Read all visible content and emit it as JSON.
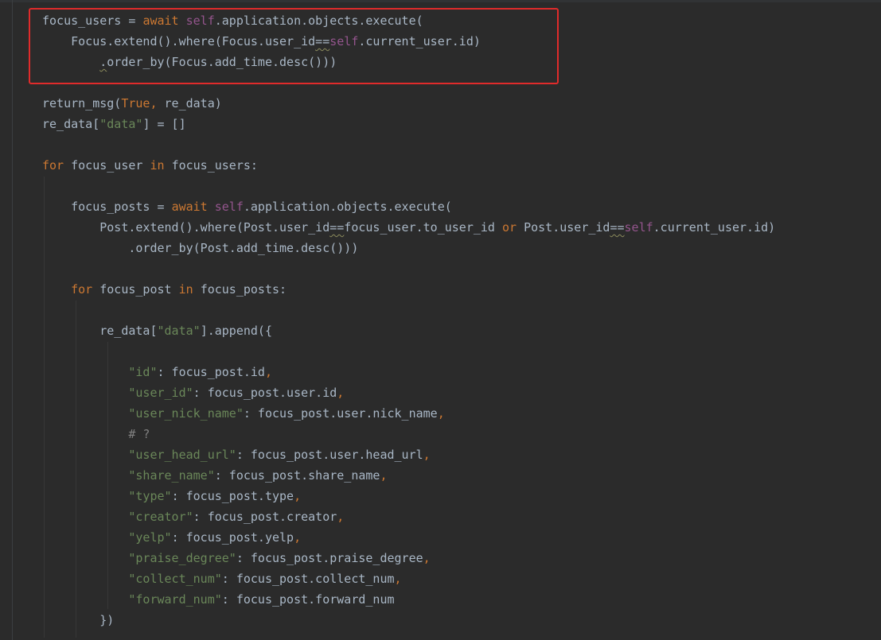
{
  "editor": {
    "highlight_color": "#e02b2b",
    "colors": {
      "background": "#2b2b2b",
      "plain": "#a9b7c6",
      "keyword": "#cc7832",
      "self": "#94558d",
      "string": "#6a8759",
      "comment": "#808080"
    },
    "lines": [
      [
        [
          "plain",
          "focus_users = "
        ],
        [
          "kw",
          "await "
        ],
        [
          "self",
          "self"
        ],
        [
          "plain",
          ".application.objects.execute("
        ]
      ],
      [
        [
          "plain",
          "    Focus.extend().where(Focus.user_id"
        ],
        [
          "warn",
          "=="
        ],
        [
          "self",
          "self"
        ],
        [
          "plain",
          ".current_user.id)"
        ]
      ],
      [
        [
          "plain",
          "        "
        ],
        [
          "warn",
          "."
        ],
        [
          "plain",
          "order_by(Focus.add_time.desc()))"
        ]
      ],
      [],
      [
        [
          "plain",
          "return_msg("
        ],
        [
          "kw",
          "True"
        ],
        [
          "punc",
          ", "
        ],
        [
          "plain",
          "re_data)"
        ]
      ],
      [
        [
          "plain",
          "re_data["
        ],
        [
          "str",
          "\"data\""
        ],
        [
          "plain",
          "] = []"
        ]
      ],
      [],
      [
        [
          "kw",
          "for "
        ],
        [
          "plain",
          "focus_user "
        ],
        [
          "kw",
          "in "
        ],
        [
          "plain",
          "focus_users:"
        ]
      ],
      [],
      [
        [
          "plain",
          "    focus_posts = "
        ],
        [
          "kw",
          "await "
        ],
        [
          "self",
          "self"
        ],
        [
          "plain",
          ".application.objects.execute("
        ]
      ],
      [
        [
          "plain",
          "        Post.extend().where(Post.user_id"
        ],
        [
          "warn",
          "=="
        ],
        [
          "plain",
          "focus_user.to_user_id "
        ],
        [
          "kw",
          "or "
        ],
        [
          "plain",
          "Post.user_id"
        ],
        [
          "warn",
          "=="
        ],
        [
          "self",
          "self"
        ],
        [
          "plain",
          ".current_user.id)"
        ]
      ],
      [
        [
          "plain",
          "            .order_by(Post.add_time.desc()))"
        ]
      ],
      [],
      [
        [
          "plain",
          "    "
        ],
        [
          "kw",
          "for "
        ],
        [
          "plain",
          "focus_post "
        ],
        [
          "kw",
          "in "
        ],
        [
          "plain",
          "focus_posts:"
        ]
      ],
      [],
      [
        [
          "plain",
          "        re_data["
        ],
        [
          "str",
          "\"data\""
        ],
        [
          "plain",
          "].append({"
        ]
      ],
      [],
      [
        [
          "plain",
          "            "
        ],
        [
          "str",
          "\"id\""
        ],
        [
          "plain",
          ": focus_post.id"
        ],
        [
          "punc",
          ","
        ]
      ],
      [
        [
          "plain",
          "            "
        ],
        [
          "str",
          "\"user_id\""
        ],
        [
          "plain",
          ": focus_post.user.id"
        ],
        [
          "punc",
          ","
        ]
      ],
      [
        [
          "plain",
          "            "
        ],
        [
          "str",
          "\"user_nick_name\""
        ],
        [
          "plain",
          ": focus_post.user.nick_name"
        ],
        [
          "punc",
          ","
        ]
      ],
      [
        [
          "plain",
          "            "
        ],
        [
          "com",
          "# ?"
        ]
      ],
      [
        [
          "plain",
          "            "
        ],
        [
          "str",
          "\"user_head_url\""
        ],
        [
          "plain",
          ": focus_post.user.head_url"
        ],
        [
          "punc",
          ","
        ]
      ],
      [
        [
          "plain",
          "            "
        ],
        [
          "str",
          "\"share_name\""
        ],
        [
          "plain",
          ": focus_post.share_name"
        ],
        [
          "punc",
          ","
        ]
      ],
      [
        [
          "plain",
          "            "
        ],
        [
          "str",
          "\"type\""
        ],
        [
          "plain",
          ": focus_post.type"
        ],
        [
          "punc",
          ","
        ]
      ],
      [
        [
          "plain",
          "            "
        ],
        [
          "str",
          "\"creator\""
        ],
        [
          "plain",
          ": focus_post.creator"
        ],
        [
          "punc",
          ","
        ]
      ],
      [
        [
          "plain",
          "            "
        ],
        [
          "str",
          "\"yelp\""
        ],
        [
          "plain",
          ": focus_post.yelp"
        ],
        [
          "punc",
          ","
        ]
      ],
      [
        [
          "plain",
          "            "
        ],
        [
          "str",
          "\"praise_degree\""
        ],
        [
          "plain",
          ": focus_post.praise_degree"
        ],
        [
          "punc",
          ","
        ]
      ],
      [
        [
          "plain",
          "            "
        ],
        [
          "str",
          "\"collect_num\""
        ],
        [
          "plain",
          ": focus_post.collect_num"
        ],
        [
          "punc",
          ","
        ]
      ],
      [
        [
          "plain",
          "            "
        ],
        [
          "str",
          "\"forward_num\""
        ],
        [
          "plain",
          ": focus_post.forward_num"
        ]
      ],
      [
        [
          "plain",
          "        })"
        ]
      ]
    ]
  }
}
